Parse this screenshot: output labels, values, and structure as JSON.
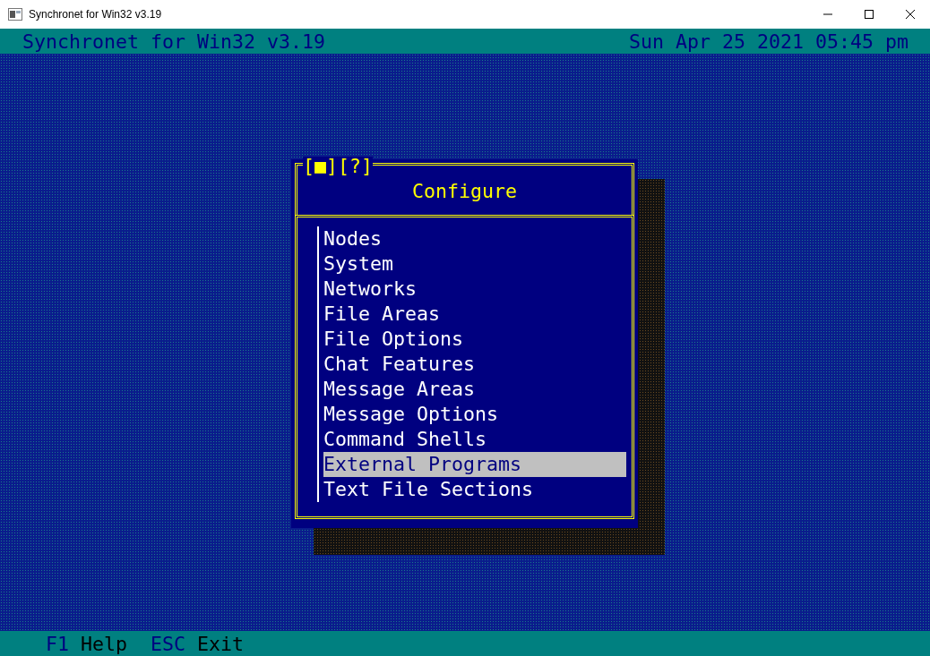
{
  "window": {
    "title": "Synchronet for Win32 v3.19"
  },
  "header": {
    "title": "Synchronet for Win32 v3.19",
    "datetime": "Sun Apr 25 2021 05:45 pm"
  },
  "dialog": {
    "controls": [
      "[■]",
      "[?]"
    ],
    "title": "Configure",
    "items": [
      {
        "label": "Nodes",
        "selected": false
      },
      {
        "label": "System",
        "selected": false
      },
      {
        "label": "Networks",
        "selected": false
      },
      {
        "label": "File Areas",
        "selected": false
      },
      {
        "label": "File Options",
        "selected": false
      },
      {
        "label": "Chat Features",
        "selected": false
      },
      {
        "label": "Message Areas",
        "selected": false
      },
      {
        "label": "Message Options",
        "selected": false
      },
      {
        "label": "Command Shells",
        "selected": false
      },
      {
        "label": "External Programs",
        "selected": true
      },
      {
        "label": "Text File Sections",
        "selected": false
      }
    ]
  },
  "status_bar": {
    "keys": [
      {
        "key": "F1",
        "action": "Help"
      },
      {
        "key": "ESC",
        "action": "Exit"
      }
    ]
  }
}
